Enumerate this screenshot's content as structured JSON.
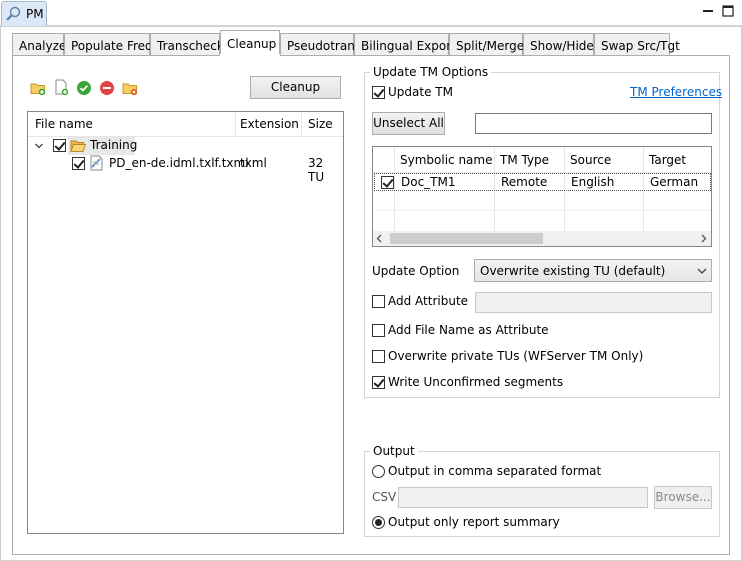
{
  "window": {
    "title": "PM"
  },
  "tabs": [
    {
      "label": "Analyze"
    },
    {
      "label": "Populate Freq"
    },
    {
      "label": "Transcheck"
    },
    {
      "label": "Cleanup"
    },
    {
      "label": "Pseudotrans"
    },
    {
      "label": "Bilingual Export"
    },
    {
      "label": "Split/Merge"
    },
    {
      "label": "Show/Hide"
    },
    {
      "label": "Swap Src/Tgt"
    }
  ],
  "active_tab": "Cleanup",
  "toolbar": {
    "icons": [
      "add-folder-icon",
      "add-file-icon",
      "check-all-icon",
      "remove-icon",
      "folder-settings-icon"
    ],
    "cleanup_label": "Cleanup"
  },
  "file_tree": {
    "columns": [
      "File name",
      "Extension",
      "Size"
    ],
    "folder": {
      "name": "Training",
      "checked": true,
      "expanded": true
    },
    "files": [
      {
        "name": "PD_en-de.idml.txlf.txml",
        "extension": "txml",
        "size": "32 TU",
        "checked": true
      }
    ]
  },
  "update_tm": {
    "group_title": "Update TM Options",
    "update_tm_label": "Update TM",
    "update_tm_checked": true,
    "preferences_link": "TM Preferences",
    "unselect_all_label": "Unselect All",
    "filter_value": "",
    "columns": [
      "Symbolic name",
      "TM Type",
      "Source",
      "Target"
    ],
    "rows": [
      {
        "checked": true,
        "name": "Doc_TM1",
        "type": "Remote",
        "source": "English",
        "target": "German"
      }
    ],
    "update_option_label": "Update Option",
    "update_option_value": "Overwrite existing TU (default)",
    "add_attribute_label": "Add Attribute",
    "add_attribute_checked": false,
    "add_attribute_value": "",
    "add_filename_label": "Add File Name as Attribute",
    "add_filename_checked": false,
    "overwrite_private_label": "Overwrite private TUs (WFServer TM Only)",
    "overwrite_private_checked": false,
    "write_unconfirmed_label": "Write Unconfirmed segments",
    "write_unconfirmed_checked": true
  },
  "output": {
    "group_title": "Output",
    "csv_option_label": "Output in comma separated format",
    "csv_label": "CSV",
    "csv_value": "",
    "browse_label": "Browse...",
    "summary_option_label": "Output only report summary",
    "selected": "summary"
  }
}
